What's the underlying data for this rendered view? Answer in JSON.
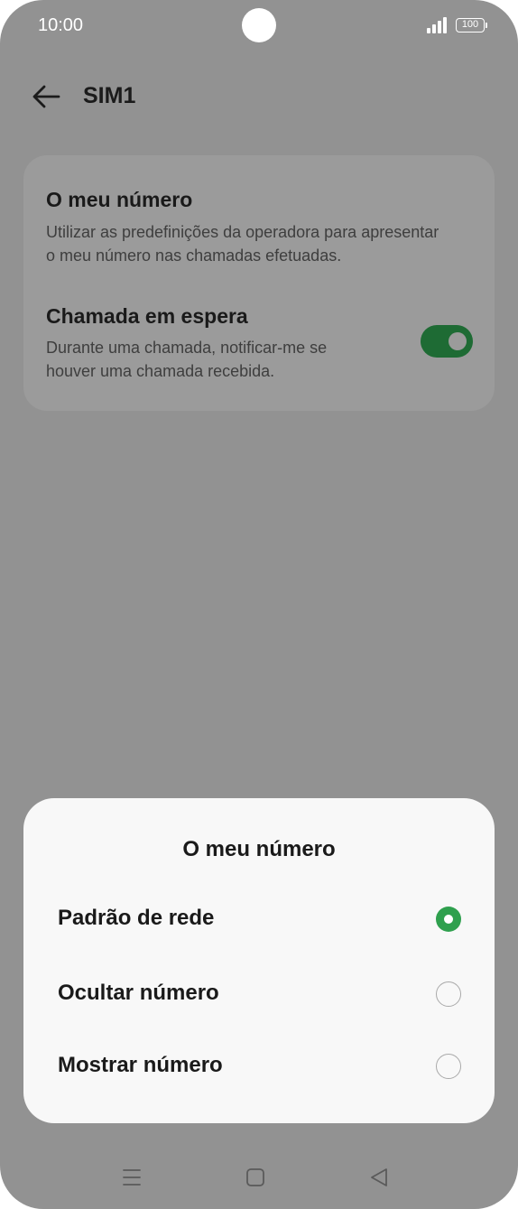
{
  "status_bar": {
    "time": "10:00",
    "battery": "100"
  },
  "header": {
    "title": "SIM1",
    "back_icon": "arrow-left-icon"
  },
  "settings": [
    {
      "title": "O meu número",
      "description": [
        "Utilizar as predefinições da operadora para apresentar",
        "o meu número nas chamadas efetuadas."
      ]
    },
    {
      "title": "Chamada em espera",
      "description": [
        "Durante uma chamada, notificar-me se",
        "houver uma chamada recebida."
      ],
      "toggle_on": true
    }
  ],
  "dialog": {
    "title": "O meu número",
    "options": [
      {
        "label": "Padrão de rede",
        "selected": true
      },
      {
        "label": "Ocultar número",
        "selected": false
      },
      {
        "label": "Mostrar número",
        "selected": false
      }
    ]
  },
  "nav_bar": {
    "icons": [
      "menu-icon",
      "home-icon",
      "back-triangle-icon"
    ]
  },
  "colors": {
    "accent": "#2fa04e",
    "toggle_on": "#1e6b34",
    "scrim": "#929292",
    "sheet": "#f8f8f8"
  }
}
